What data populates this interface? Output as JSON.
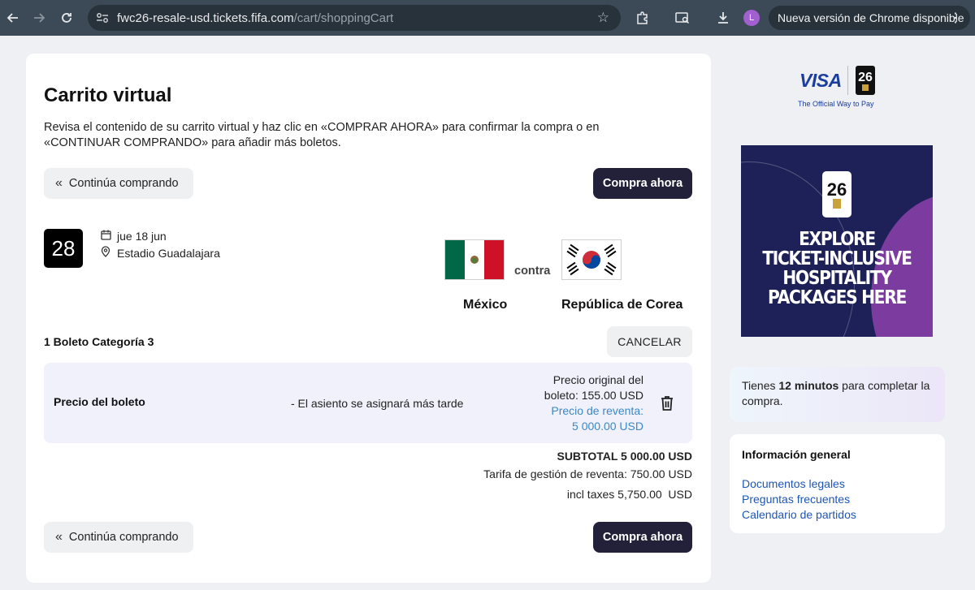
{
  "browser": {
    "url_domain": "fwc26-resale-usd.tickets.fifa.com",
    "url_path": "/cart/shoppingCart",
    "avatar_letter": "L",
    "update_label": "Nueva versión de Chrome disponible"
  },
  "cart": {
    "title": "Carrito virtual",
    "description": "Revisa el contenido de su carrito virtual y haz clic en «COMPRAR AHORA» para confirmar la compra o en «CONTINUAR COMPRANDO» para añadir más boletos.",
    "continue_label": "Continúa comprando",
    "buy_label": "Compra ahora"
  },
  "match": {
    "day": "28",
    "date": "jue 18 jun",
    "stadium": "Estadio Guadalajara",
    "versus": "contra",
    "home_team": "México",
    "away_team": "República de Corea"
  },
  "tickets": {
    "count_label": "1 Boleto Categoría 3",
    "cancel_label": "CANCELAR",
    "row_label": "Precio del boleto",
    "seat_note": "- El asiento se asignará más tarde",
    "original_price_line1": "Precio original del",
    "original_price_line2": "boleto: 155.00 USD",
    "resale_line1": "Precio de reventa:",
    "resale_line2": "5 000.00 USD"
  },
  "totals": {
    "subtotal": "SUBTOTAL 5 000.00 USD",
    "fee": "Tarifa de gestión de reventa: 750.00 USD",
    "incl_taxes": "incl taxes 5,750.00  USD"
  },
  "sidebar": {
    "visa_word": "VISA",
    "visa_tagline": "The Official Way to Pay",
    "banner_line1": "EXPLORE",
    "banner_line2": "TICKET-INCLUSIVE",
    "banner_line3": "HOSPITALITY",
    "banner_line4": "PACKAGES HERE",
    "timer_prefix": "Tienes ",
    "timer_minutes": "12 minutos",
    "timer_suffix": " para completar la compra.",
    "info_title": "Información general",
    "links": [
      "Documentos legales",
      "Preguntas frecuentes",
      "Calendario de partidos"
    ]
  },
  "colors": {
    "primary_button": "#23213a",
    "resale_price": "#3d88c6",
    "link": "#1f56b4"
  }
}
